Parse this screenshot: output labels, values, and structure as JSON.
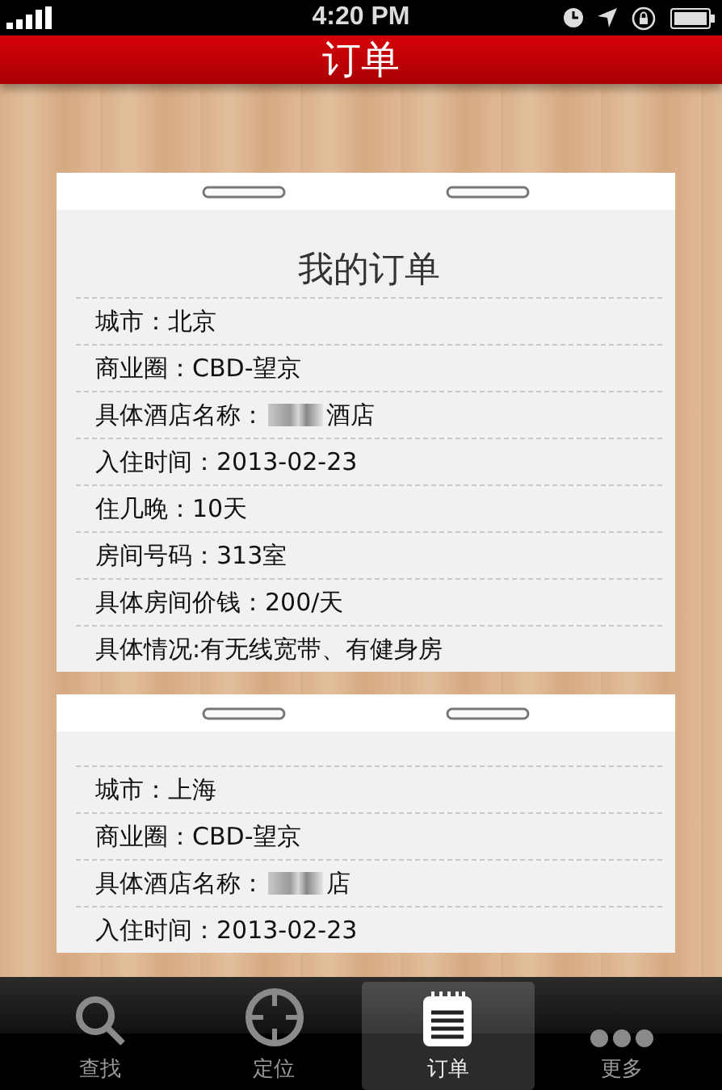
{
  "status_bar": {
    "time": "4:20 PM"
  },
  "nav_bar": {
    "title": "订单"
  },
  "cards": [
    {
      "title": "我的订单",
      "rows": [
        {
          "text": "城市：北京"
        },
        {
          "text": "商业圈：CBD-望京"
        },
        {
          "text": "具体酒店名称：",
          "redacted": true,
          "after": "酒店"
        },
        {
          "text": "入住时间：2013-02-23"
        },
        {
          "text": "住几晚：10天"
        },
        {
          "text": "房间号码：313室"
        },
        {
          "text": "具体房间价钱：200/天"
        },
        {
          "text": "具体情况:有无线宽带、有健身房"
        }
      ]
    },
    {
      "rows": [
        {
          "text": "城市：上海"
        },
        {
          "text": "商业圈：CBD-望京"
        },
        {
          "text": "具体酒店名称：",
          "redacted": true,
          "after": "店"
        },
        {
          "text": "入住时间：2013-02-23"
        }
      ]
    }
  ],
  "tab_bar": [
    {
      "kind": "search",
      "label": "查找",
      "selected": false
    },
    {
      "kind": "locate",
      "label": "定位",
      "selected": false
    },
    {
      "kind": "orders",
      "label": "订单",
      "selected": true
    },
    {
      "kind": "more",
      "label": "更多",
      "selected": false
    }
  ]
}
